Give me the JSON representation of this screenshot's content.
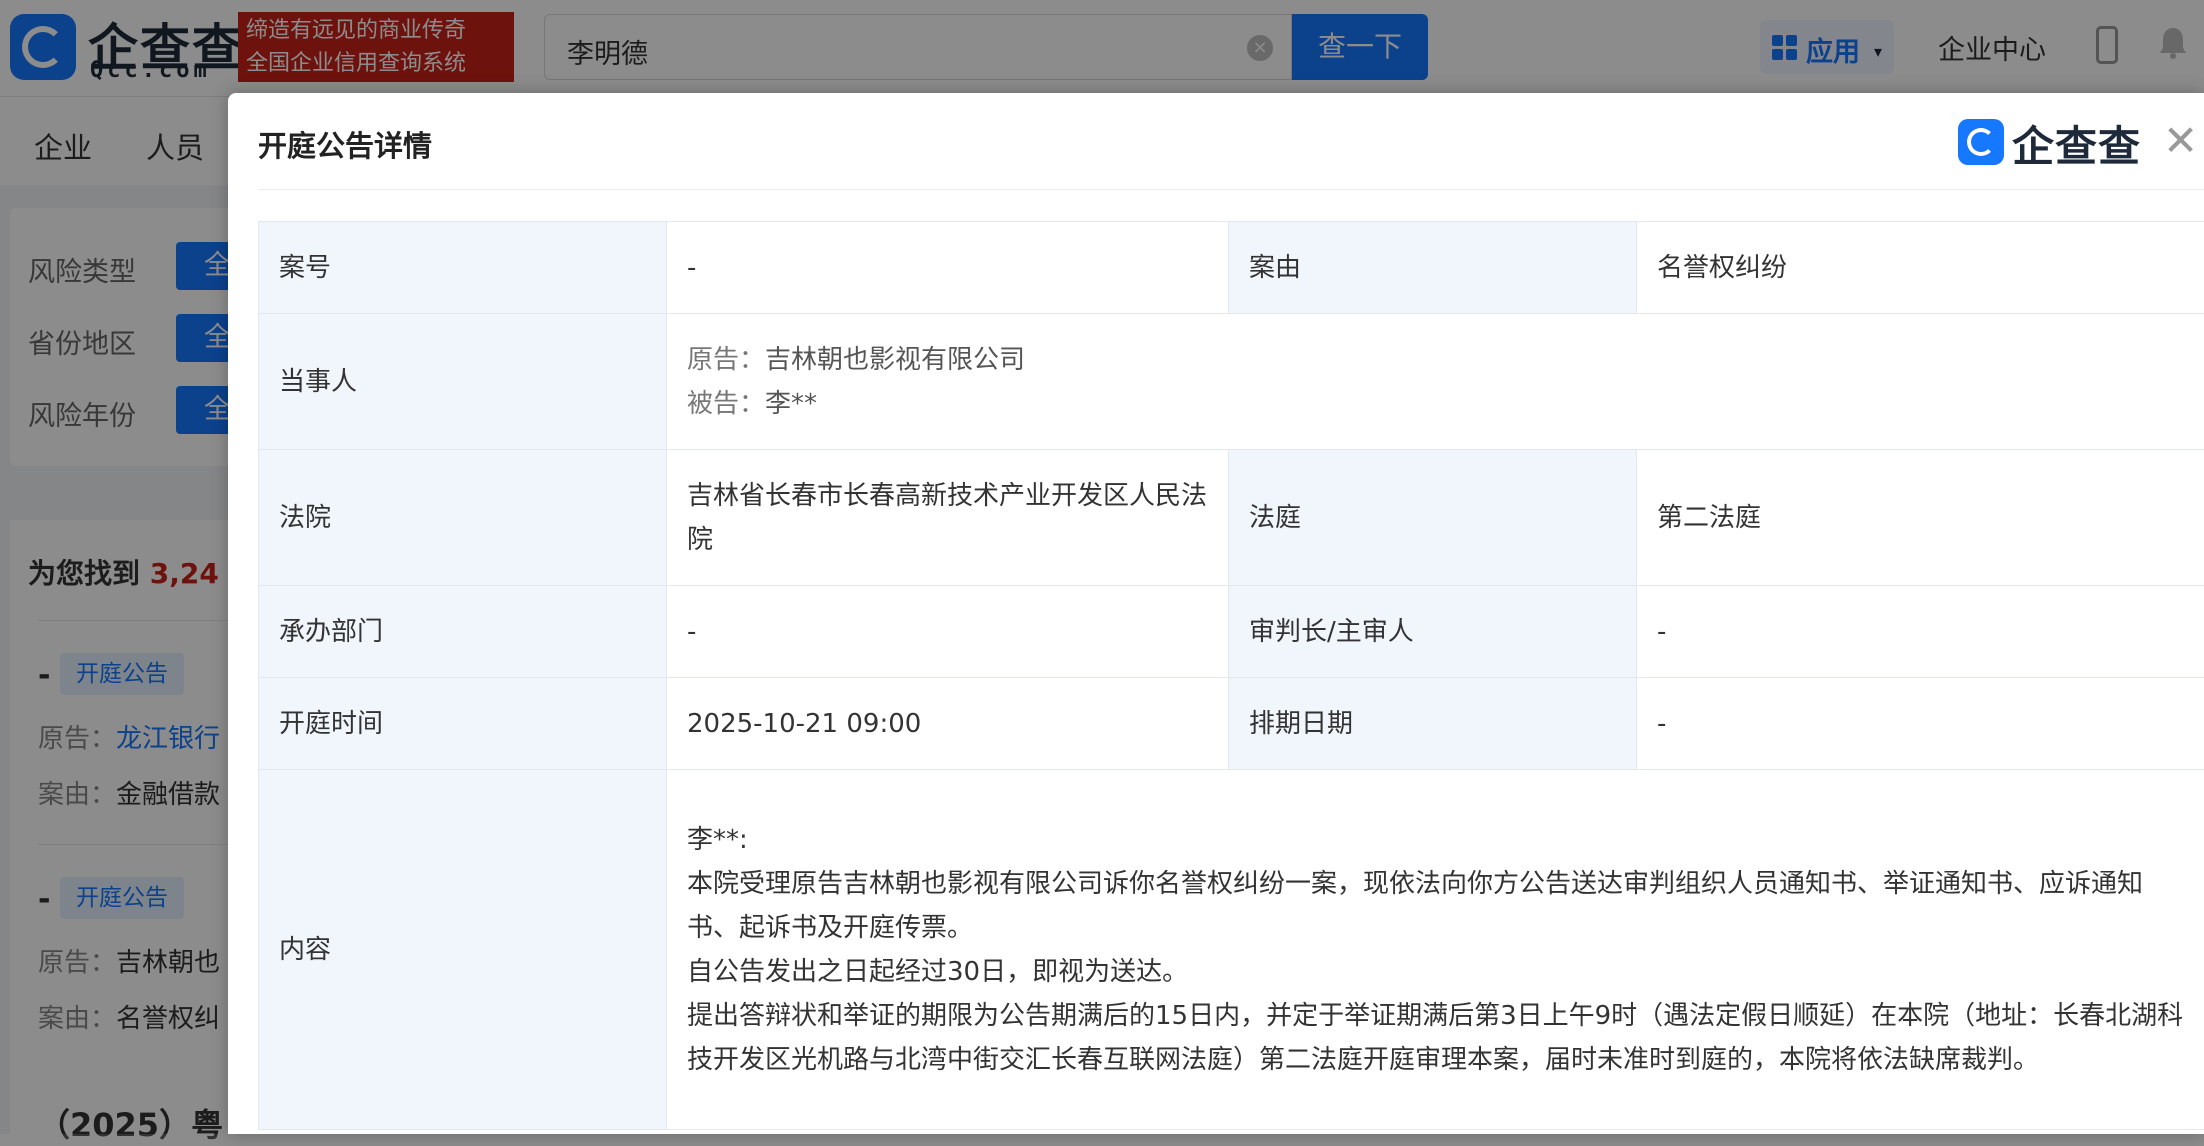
{
  "header": {
    "logo_text": "企查查",
    "logo_sub": "Qcc.com",
    "slogan_line1": "缔造有远见的商业传奇",
    "slogan_line2": "全国企业信用查询系统",
    "search_value": "李明德",
    "search_clear": "×",
    "search_button": "查一下",
    "apps_label": "应用",
    "apps_caret": "▾",
    "enterprise_center": "企业中心"
  },
  "nav": {
    "items": [
      "企业",
      "人员"
    ]
  },
  "filters": [
    {
      "label": "风险类型",
      "button": "全"
    },
    {
      "label": "省份地区",
      "button": "全"
    },
    {
      "label": "风险年份",
      "button": "全"
    }
  ],
  "results": {
    "found_prefix": "为您找到",
    "found_count": "3,24",
    "items": [
      {
        "dash": "-",
        "tag": "开庭公告",
        "line1_label": "原告：",
        "line1_value": "龙江银行",
        "line2_label": "案由：",
        "line2_value": "金融借款"
      },
      {
        "dash": "-",
        "tag": "开庭公告",
        "line1_label": "原告：",
        "line1_value": "吉林朝也",
        "line2_label": "案由：",
        "line2_value": "名誉权纠"
      }
    ],
    "bottom_title": "（2025）粤"
  },
  "modal": {
    "title": "开庭公告详情",
    "brand": "企查查",
    "close": "✕",
    "rows": {
      "case_no_label": "案号",
      "case_no_value": "-",
      "cause_label": "案由",
      "cause_value": "名誉权纠纷",
      "parties_label": "当事人",
      "plaintiff_label": "原告：",
      "plaintiff_value": "吉林朝也影视有限公司",
      "defendant_label": "被告：",
      "defendant_value": "李**",
      "court_label": "法院",
      "court_value": "吉林省长春市长春高新技术产业开发区人民法院",
      "tribunal_label": "法庭",
      "tribunal_value": "第二法庭",
      "dept_label": "承办部门",
      "dept_value": "-",
      "judge_label": "审判长/主审人",
      "judge_value": "-",
      "hearing_time_label": "开庭时间",
      "hearing_time_value": "2025-10-21 09:00",
      "schedule_label": "排期日期",
      "schedule_value": "-",
      "content_label": "内容",
      "content_lines": [
        "李**:",
        "本院受理原告吉林朝也影视有限公司诉你名誉权纠纷一案，现依法向你方公告送达审判组织人员通知书、举证通知书、应诉通知书、起诉书及开庭传票。",
        "自公告发出之日起经过30日，即视为送达。",
        "提出答辩状和举证的期限为公告期满后的15日内，并定于举证期满后第3日上午9时（遇法定假日顺延）在本院（地址：长春北湖科技开发区光机路与北湾中街交汇长春互联网法庭）第二法庭开庭审理本案，届时未准时到庭的，本院将依法缺席裁判。"
      ]
    }
  },
  "colors": {
    "accent": "#1677ff",
    "slogan_bg": "#c8221b",
    "label_cell_bg": "#f1f6fc"
  }
}
